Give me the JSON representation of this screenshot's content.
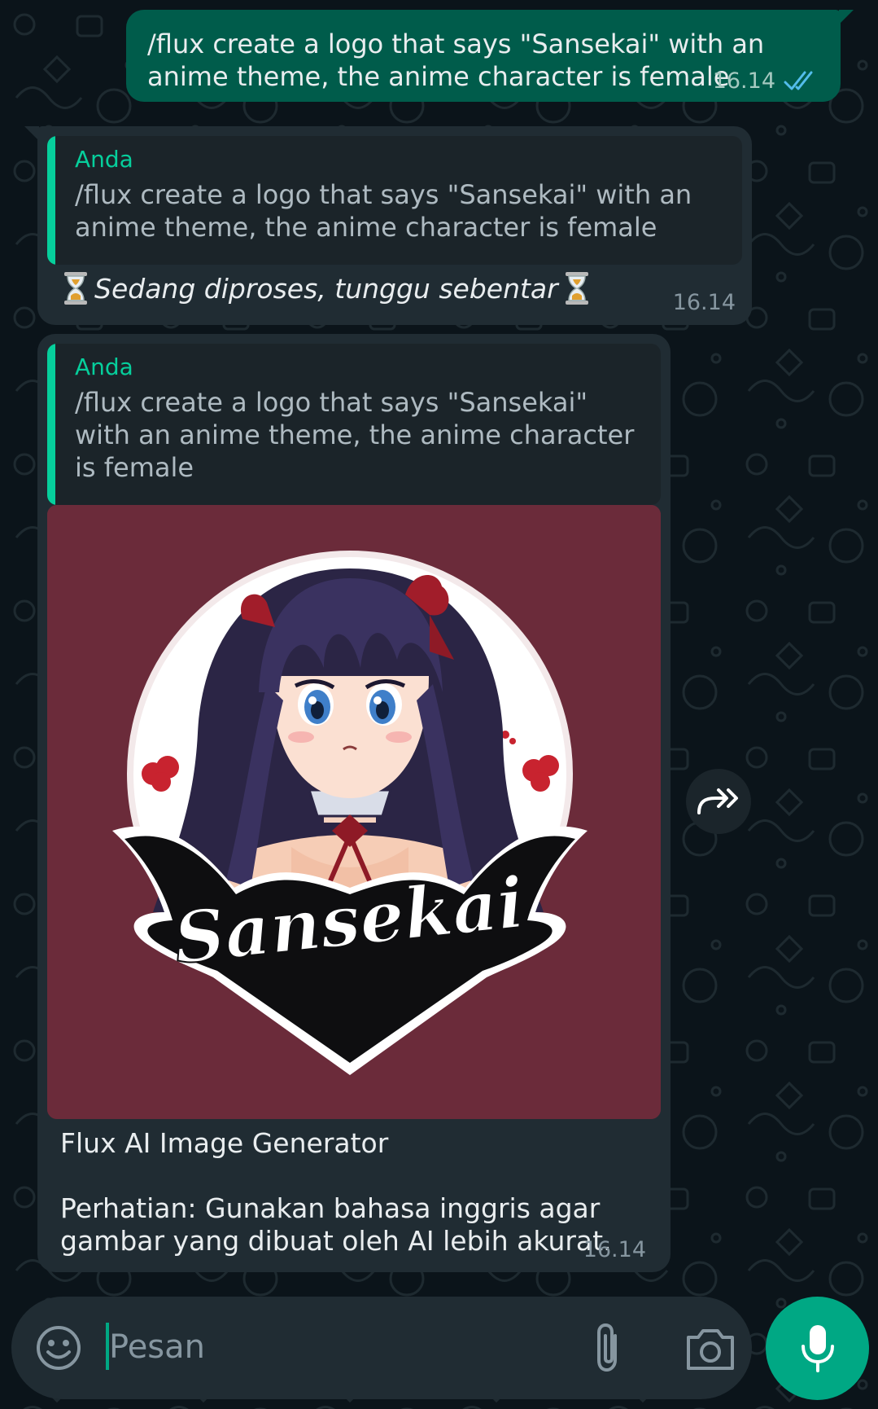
{
  "theme": {
    "background": "#0b141a",
    "outgoing_bubble": "#005c4b",
    "incoming_bubble": "#202c33",
    "accent": "#06cf9c",
    "read_ticks": "#53bdeb"
  },
  "messages": [
    {
      "direction": "outgoing",
      "text": "/flux create a logo that says \"Sansekai\" with an anime theme, the anime character is female",
      "time": "16.14",
      "status_icon": "double-check-read-icon"
    },
    {
      "direction": "incoming",
      "quote": {
        "author": "Anda",
        "text": "/flux create a logo that says \"Sansekai\" with an anime theme, the anime character is female"
      },
      "text": "Sedang diproses, tunggu sebentar",
      "emoji": "hourglass-icon",
      "time": "16.14"
    },
    {
      "direction": "incoming",
      "quote": {
        "author": "Anda",
        "text": "/flux create a logo that says \"Sansekai\" with an anime theme, the anime character is female"
      },
      "image_text": "Sansekai",
      "caption_title": "Flux AI Image Generator",
      "caption_body": "Perhatian: Gunakan bahasa inggris agar gambar yang dibuat oleh AI lebih akurat.",
      "time": "16.14"
    }
  ],
  "forward_icon": "forward-icon",
  "composer": {
    "placeholder": "Pesan",
    "value": "",
    "icons": [
      "emoji-icon",
      "attach-icon",
      "camera-icon",
      "mic-icon"
    ]
  }
}
